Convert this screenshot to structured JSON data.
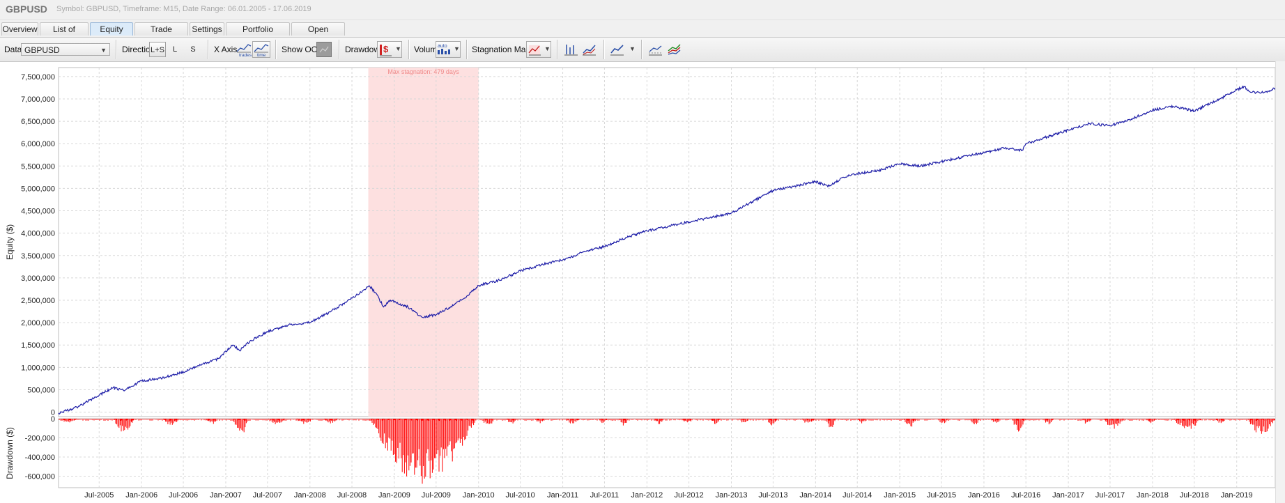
{
  "header": {
    "symbol": "GBPUSD",
    "subtitle": "Symbol: GBPUSD, Timeframe: M15, Date Range: 06.01.2005 - 17.06.2019"
  },
  "tabs": [
    {
      "label": "Overview",
      "active": false
    },
    {
      "label": "List of trades",
      "active": false
    },
    {
      "label": "Equity chart",
      "active": true
    },
    {
      "label": "Trade analysis",
      "active": false
    },
    {
      "label": "Settings",
      "active": false
    },
    {
      "label": "Portfolio correlation",
      "active": false
    },
    {
      "label": "Open balances",
      "active": false
    }
  ],
  "toolbar": {
    "data_label": "Data",
    "data_value": "GBPUSD",
    "direction_label": "Direction",
    "direction_options": [
      "L+S",
      "L",
      "S"
    ],
    "direction_selected": "L+S",
    "xaxis_label": "X Axis",
    "xaxis_trades": "trades",
    "xaxis_time": "time",
    "show_oos_label": "Show OOS",
    "drawdown_label": "Drawdown",
    "drawdown_icon": "$",
    "volume_label": "Volume",
    "volume_icon": "auto",
    "stagnation_label": "Stagnation Marker"
  },
  "colors": {
    "equity": "#1f1fa8",
    "drawdown": "#ff0000",
    "stagnation": "#fde0e0",
    "stagnation_text": "#f08a8a",
    "grid": "#d8d8d8"
  },
  "chart_data": [
    {
      "type": "line",
      "ylabel": "Equity ($)",
      "ylim": [
        -100000,
        7700000
      ],
      "yticks": [
        "7,500,000",
        "7,000,000",
        "6,500,000",
        "6,000,000",
        "5,500,000",
        "5,000,000",
        "4,500,000",
        "4,000,000",
        "3,500,000",
        "3,000,000",
        "2,500,000",
        "2,000,000",
        "1,500,000",
        "1,000,000",
        "500,000",
        "0"
      ],
      "ytick_values": [
        7500000,
        7000000,
        6500000,
        6000000,
        5500000,
        5000000,
        4500000,
        4000000,
        3500000,
        3000000,
        2500000,
        2000000,
        1500000,
        1000000,
        500000,
        0
      ],
      "xlim": [
        "2005-01-06",
        "2019-06-17"
      ],
      "grid": true,
      "stagnation": {
        "label": "Max stagnation: 479 days",
        "start": "2008-09-10",
        "end": "2010-01-01"
      },
      "series": [
        {
          "points": [
            [
              "2005-01-06",
              -20000
            ],
            [
              "2005-04-01",
              120000
            ],
            [
              "2005-07-01",
              380000
            ],
            [
              "2005-09-01",
              550000
            ],
            [
              "2005-10-15",
              480000
            ],
            [
              "2006-01-01",
              700000
            ],
            [
              "2006-04-01",
              760000
            ],
            [
              "2006-07-01",
              900000
            ],
            [
              "2006-10-01",
              1080000
            ],
            [
              "2006-12-01",
              1200000
            ],
            [
              "2007-02-01",
              1500000
            ],
            [
              "2007-03-01",
              1380000
            ],
            [
              "2007-04-15",
              1580000
            ],
            [
              "2007-07-01",
              1800000
            ],
            [
              "2007-10-01",
              1950000
            ],
            [
              "2008-01-01",
              2000000
            ],
            [
              "2008-04-01",
              2250000
            ],
            [
              "2008-07-01",
              2550000
            ],
            [
              "2008-09-15",
              2820000
            ],
            [
              "2008-10-15",
              2650000
            ],
            [
              "2008-11-15",
              2350000
            ],
            [
              "2008-12-15",
              2500000
            ],
            [
              "2009-03-01",
              2350000
            ],
            [
              "2009-05-01",
              2120000
            ],
            [
              "2009-07-01",
              2180000
            ],
            [
              "2009-09-01",
              2350000
            ],
            [
              "2009-11-01",
              2550000
            ],
            [
              "2010-01-01",
              2830000
            ],
            [
              "2010-04-01",
              2950000
            ],
            [
              "2010-07-01",
              3150000
            ],
            [
              "2010-10-01",
              3300000
            ],
            [
              "2011-01-01",
              3400000
            ],
            [
              "2011-04-01",
              3580000
            ],
            [
              "2011-07-01",
              3700000
            ],
            [
              "2011-10-01",
              3900000
            ],
            [
              "2012-01-01",
              4050000
            ],
            [
              "2012-04-01",
              4150000
            ],
            [
              "2012-07-01",
              4250000
            ],
            [
              "2012-10-01",
              4350000
            ],
            [
              "2013-01-01",
              4450000
            ],
            [
              "2013-04-01",
              4700000
            ],
            [
              "2013-07-01",
              4950000
            ],
            [
              "2013-10-01",
              5050000
            ],
            [
              "2014-01-01",
              5150000
            ],
            [
              "2014-03-01",
              5050000
            ],
            [
              "2014-05-01",
              5250000
            ],
            [
              "2014-07-01",
              5330000
            ],
            [
              "2014-10-01",
              5400000
            ],
            [
              "2015-01-01",
              5550000
            ],
            [
              "2015-04-01",
              5500000
            ],
            [
              "2015-07-01",
              5600000
            ],
            [
              "2015-10-01",
              5700000
            ],
            [
              "2016-01-01",
              5800000
            ],
            [
              "2016-04-01",
              5900000
            ],
            [
              "2016-06-15",
              5850000
            ],
            [
              "2016-07-01",
              6000000
            ],
            [
              "2016-10-01",
              6150000
            ],
            [
              "2017-01-01",
              6300000
            ],
            [
              "2017-04-01",
              6450000
            ],
            [
              "2017-07-01",
              6400000
            ],
            [
              "2017-10-01",
              6550000
            ],
            [
              "2018-01-01",
              6750000
            ],
            [
              "2018-04-01",
              6830000
            ],
            [
              "2018-07-01",
              6730000
            ],
            [
              "2018-10-01",
              6950000
            ],
            [
              "2019-01-01",
              7200000
            ],
            [
              "2019-02-01",
              7280000
            ],
            [
              "2019-03-01",
              7150000
            ],
            [
              "2019-05-01",
              7150000
            ],
            [
              "2019-06-17",
              7230000
            ]
          ]
        }
      ]
    },
    {
      "type": "bar",
      "ylabel": "Drawdown ($)",
      "ylim": [
        -720000,
        0
      ],
      "yticks": [
        "0",
        "-200,000",
        "-400,000",
        "-600,000"
      ],
      "ytick_values": [
        0,
        -200000,
        -400000,
        -600000
      ],
      "xticks": [
        "Jul-2005",
        "Jan-2006",
        "Jul-2006",
        "Jan-2007",
        "Jul-2007",
        "Jan-2008",
        "Jul-2008",
        "Jan-2009",
        "Jul-2009",
        "Jan-2010",
        "Jul-2010",
        "Jan-2011",
        "Jul-2011",
        "Jan-2012",
        "Jul-2012",
        "Jan-2013",
        "Jul-2013",
        "Jan-2014",
        "Jul-2014",
        "Jan-2015",
        "Jul-2015",
        "Jan-2016",
        "Jul-2016",
        "Jan-2017",
        "Jul-2017",
        "Jan-2018",
        "Jul-2018",
        "Jan-2019"
      ],
      "xtick_dates": [
        "2005-07-01",
        "2006-01-01",
        "2006-07-01",
        "2007-01-01",
        "2007-07-01",
        "2008-01-01",
        "2008-07-01",
        "2009-01-01",
        "2009-07-01",
        "2010-01-01",
        "2010-07-01",
        "2011-01-01",
        "2011-07-01",
        "2012-01-01",
        "2012-07-01",
        "2013-01-01",
        "2013-07-01",
        "2014-01-01",
        "2014-07-01",
        "2015-01-01",
        "2015-07-01",
        "2016-01-01",
        "2016-07-01",
        "2017-01-01",
        "2017-07-01",
        "2018-01-01",
        "2018-07-01",
        "2019-01-01"
      ],
      "episodes": [
        [
          "2005-01-06",
          "2005-04-01",
          40000
        ],
        [
          "2005-09-01",
          "2005-12-01",
          160000
        ],
        [
          "2006-04-01",
          "2006-06-15",
          70000
        ],
        [
          "2006-10-01",
          "2006-12-01",
          60000
        ],
        [
          "2007-02-01",
          "2007-04-10",
          180000
        ],
        [
          "2007-07-01",
          "2007-09-15",
          70000
        ],
        [
          "2007-11-01",
          "2008-01-15",
          60000
        ],
        [
          "2008-03-01",
          "2008-05-01",
          50000
        ],
        [
          "2008-09-12",
          "2009-12-25",
          690000
        ],
        [
          "2010-01-15",
          "2010-03-15",
          90000
        ],
        [
          "2010-05-01",
          "2010-06-15",
          70000
        ],
        [
          "2010-09-01",
          "2010-10-15",
          50000
        ],
        [
          "2011-01-15",
          "2011-03-15",
          60000
        ],
        [
          "2011-06-01",
          "2011-07-15",
          50000
        ],
        [
          "2011-09-01",
          "2011-10-15",
          80000
        ],
        [
          "2012-02-01",
          "2012-03-15",
          60000
        ],
        [
          "2012-06-01",
          "2012-07-20",
          50000
        ],
        [
          "2012-10-01",
          "2012-11-15",
          60000
        ],
        [
          "2013-02-01",
          "2013-03-20",
          50000
        ],
        [
          "2013-06-01",
          "2013-07-20",
          70000
        ],
        [
          "2013-11-01",
          "2014-01-01",
          60000
        ],
        [
          "2014-02-15",
          "2014-04-01",
          120000
        ],
        [
          "2014-07-01",
          "2014-08-15",
          50000
        ],
        [
          "2015-01-15",
          "2015-03-20",
          90000
        ],
        [
          "2015-06-15",
          "2015-08-01",
          60000
        ],
        [
          "2015-11-01",
          "2015-12-15",
          80000
        ],
        [
          "2016-02-01",
          "2016-03-15",
          60000
        ],
        [
          "2016-05-01",
          "2016-07-01",
          140000
        ],
        [
          "2016-09-15",
          "2016-11-01",
          70000
        ],
        [
          "2017-03-01",
          "2017-04-15",
          60000
        ],
        [
          "2017-06-01",
          "2017-09-01",
          110000
        ],
        [
          "2017-12-01",
          "2018-01-15",
          50000
        ],
        [
          "2018-04-01",
          "2018-08-01",
          120000
        ],
        [
          "2018-10-01",
          "2018-11-15",
          60000
        ],
        [
          "2019-02-15",
          "2019-06-17",
          170000
        ]
      ]
    }
  ]
}
